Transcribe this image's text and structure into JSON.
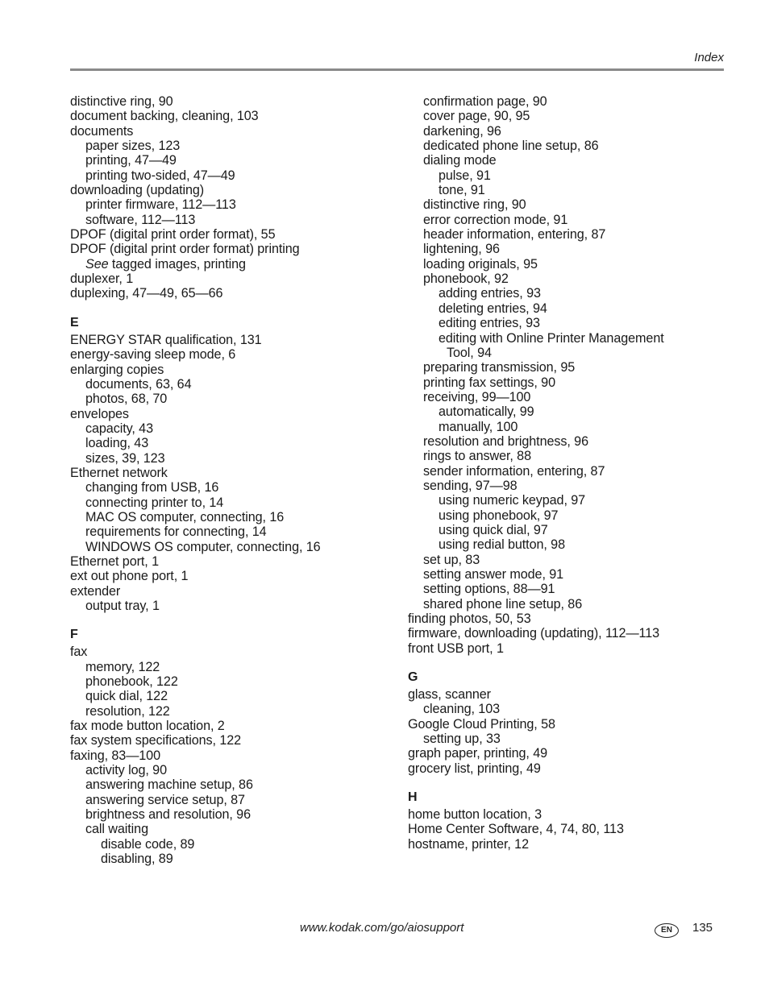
{
  "header": {
    "title": "Index"
  },
  "left_column": [
    {
      "type": "entry",
      "level": 0,
      "text": "distinctive ring, 90"
    },
    {
      "type": "entry",
      "level": 0,
      "text": "document backing, cleaning, 103"
    },
    {
      "type": "entry",
      "level": 0,
      "text": "documents"
    },
    {
      "type": "entry",
      "level": 1,
      "text": "paper sizes, 123"
    },
    {
      "type": "entry",
      "level": 1,
      "text": "printing, 47—49"
    },
    {
      "type": "entry",
      "level": 1,
      "text": "printing two-sided, 47—49"
    },
    {
      "type": "entry",
      "level": 0,
      "text": "downloading (updating)"
    },
    {
      "type": "entry",
      "level": 1,
      "text": "printer firmware, 112—113"
    },
    {
      "type": "entry",
      "level": 1,
      "text": "software, 112—113"
    },
    {
      "type": "entry",
      "level": 0,
      "text": "DPOF (digital print order format), 55"
    },
    {
      "type": "entry",
      "level": 0,
      "text": "DPOF (digital print order format) printing"
    },
    {
      "type": "see",
      "level": 1,
      "see_label": "See",
      "text": " tagged images, printing"
    },
    {
      "type": "entry",
      "level": 0,
      "text": "duplexer, 1"
    },
    {
      "type": "entry",
      "level": 0,
      "text": "duplexing, 47—49, 65—66"
    },
    {
      "type": "letter",
      "text": "E"
    },
    {
      "type": "entry",
      "level": 0,
      "text": "ENERGY STAR qualification, 131"
    },
    {
      "type": "entry",
      "level": 0,
      "text": "energy-saving sleep mode, 6"
    },
    {
      "type": "entry",
      "level": 0,
      "text": "enlarging copies"
    },
    {
      "type": "entry",
      "level": 1,
      "text": "documents, 63, 64"
    },
    {
      "type": "entry",
      "level": 1,
      "text": "photos, 68, 70"
    },
    {
      "type": "entry",
      "level": 0,
      "text": "envelopes"
    },
    {
      "type": "entry",
      "level": 1,
      "text": "capacity, 43"
    },
    {
      "type": "entry",
      "level": 1,
      "text": "loading, 43"
    },
    {
      "type": "entry",
      "level": 1,
      "text": "sizes, 39, 123"
    },
    {
      "type": "entry",
      "level": 0,
      "text": "Ethernet network"
    },
    {
      "type": "entry",
      "level": 1,
      "text": "changing from USB, 16"
    },
    {
      "type": "entry",
      "level": 1,
      "text": "connecting printer to, 14"
    },
    {
      "type": "entry",
      "level": 1,
      "text": "MAC OS computer, connecting, 16"
    },
    {
      "type": "entry",
      "level": 1,
      "text": "requirements for connecting, 14"
    },
    {
      "type": "entry",
      "level": 1,
      "text": "WINDOWS OS computer, connecting, 16"
    },
    {
      "type": "entry",
      "level": 0,
      "text": "Ethernet port, 1"
    },
    {
      "type": "entry",
      "level": 0,
      "text": "ext out phone port, 1"
    },
    {
      "type": "entry",
      "level": 0,
      "text": "extender"
    },
    {
      "type": "entry",
      "level": 1,
      "text": "output tray, 1"
    },
    {
      "type": "letter",
      "text": "F"
    },
    {
      "type": "entry",
      "level": 0,
      "text": "fax"
    },
    {
      "type": "entry",
      "level": 1,
      "text": "memory, 122"
    },
    {
      "type": "entry",
      "level": 1,
      "text": "phonebook, 122"
    },
    {
      "type": "entry",
      "level": 1,
      "text": "quick dial, 122"
    },
    {
      "type": "entry",
      "level": 1,
      "text": "resolution, 122"
    },
    {
      "type": "entry",
      "level": 0,
      "text": "fax mode button location, 2"
    },
    {
      "type": "entry",
      "level": 0,
      "text": "fax system specifications, 122"
    },
    {
      "type": "entry",
      "level": 0,
      "text": "faxing, 83—100"
    },
    {
      "type": "entry",
      "level": 1,
      "text": "activity log, 90"
    },
    {
      "type": "entry",
      "level": 1,
      "text": "answering machine setup, 86"
    },
    {
      "type": "entry",
      "level": 1,
      "text": "answering service setup, 87"
    },
    {
      "type": "entry",
      "level": 1,
      "text": "brightness and resolution, 96"
    },
    {
      "type": "entry",
      "level": 1,
      "text": "call waiting"
    },
    {
      "type": "entry",
      "level": 2,
      "text": "disable code, 89"
    },
    {
      "type": "entry",
      "level": 2,
      "text": "disabling, 89"
    }
  ],
  "right_column": [
    {
      "type": "entry",
      "level": 1,
      "text": "confirmation page, 90"
    },
    {
      "type": "entry",
      "level": 1,
      "text": "cover page, 90, 95"
    },
    {
      "type": "entry",
      "level": 1,
      "text": "darkening, 96"
    },
    {
      "type": "entry",
      "level": 1,
      "text": "dedicated phone line setup, 86"
    },
    {
      "type": "entry",
      "level": 1,
      "text": "dialing mode"
    },
    {
      "type": "entry",
      "level": 2,
      "text": "pulse, 91"
    },
    {
      "type": "entry",
      "level": 2,
      "text": "tone, 91"
    },
    {
      "type": "entry",
      "level": 1,
      "text": "distinctive ring, 90"
    },
    {
      "type": "entry",
      "level": 1,
      "text": "error correction mode, 91"
    },
    {
      "type": "entry",
      "level": 1,
      "text": "header information, entering, 87"
    },
    {
      "type": "entry",
      "level": 1,
      "text": "lightening, 96"
    },
    {
      "type": "entry",
      "level": 1,
      "text": "loading originals, 95"
    },
    {
      "type": "entry",
      "level": 1,
      "text": "phonebook, 92"
    },
    {
      "type": "entry",
      "level": 2,
      "text": "adding entries, 93"
    },
    {
      "type": "entry",
      "level": 2,
      "text": "deleting entries, 94"
    },
    {
      "type": "entry",
      "level": 2,
      "text": "editing entries, 93"
    },
    {
      "type": "entry",
      "level": 2,
      "text": "editing with Online Printer Management"
    },
    {
      "type": "entry",
      "level": 3,
      "text": "Tool, 94"
    },
    {
      "type": "entry",
      "level": 1,
      "text": "preparing transmission, 95"
    },
    {
      "type": "entry",
      "level": 1,
      "text": "printing fax settings, 90"
    },
    {
      "type": "entry",
      "level": 1,
      "text": "receiving, 99—100"
    },
    {
      "type": "entry",
      "level": 2,
      "text": "automatically, 99"
    },
    {
      "type": "entry",
      "level": 2,
      "text": "manually, 100"
    },
    {
      "type": "entry",
      "level": 1,
      "text": "resolution and brightness, 96"
    },
    {
      "type": "entry",
      "level": 1,
      "text": "rings to answer, 88"
    },
    {
      "type": "entry",
      "level": 1,
      "text": "sender information, entering, 87"
    },
    {
      "type": "entry",
      "level": 1,
      "text": "sending, 97—98"
    },
    {
      "type": "entry",
      "level": 2,
      "text": "using numeric keypad, 97"
    },
    {
      "type": "entry",
      "level": 2,
      "text": "using phonebook, 97"
    },
    {
      "type": "entry",
      "level": 2,
      "text": "using quick dial, 97"
    },
    {
      "type": "entry",
      "level": 2,
      "text": "using redial button, 98"
    },
    {
      "type": "entry",
      "level": 1,
      "text": "set up, 83"
    },
    {
      "type": "entry",
      "level": 1,
      "text": "setting answer mode, 91"
    },
    {
      "type": "entry",
      "level": 1,
      "text": "setting options, 88—91"
    },
    {
      "type": "entry",
      "level": 1,
      "text": "shared phone line setup, 86"
    },
    {
      "type": "entry",
      "level": 0,
      "text": "finding photos, 50, 53"
    },
    {
      "type": "entry",
      "level": 0,
      "text": "firmware, downloading (updating), 112—113"
    },
    {
      "type": "entry",
      "level": 0,
      "text": "front USB port, 1"
    },
    {
      "type": "letter",
      "text": "G"
    },
    {
      "type": "entry",
      "level": 0,
      "text": "glass, scanner"
    },
    {
      "type": "entry",
      "level": 1,
      "text": "cleaning, 103"
    },
    {
      "type": "entry",
      "level": 0,
      "text": "Google Cloud Printing, 58"
    },
    {
      "type": "entry",
      "level": 1,
      "text": "setting up, 33"
    },
    {
      "type": "entry",
      "level": 0,
      "text": "graph paper, printing, 49"
    },
    {
      "type": "entry",
      "level": 0,
      "text": "grocery list, printing, 49"
    },
    {
      "type": "letter",
      "text": "H"
    },
    {
      "type": "entry",
      "level": 0,
      "text": "home button location, 3"
    },
    {
      "type": "entry",
      "level": 0,
      "text": "Home Center Software, 4, 74, 80, 113"
    },
    {
      "type": "entry",
      "level": 0,
      "text": "hostname, printer, 12"
    }
  ],
  "footer": {
    "url": "www.kodak.com/go/aiosupport",
    "language_badge": "EN",
    "page_number": "135"
  }
}
